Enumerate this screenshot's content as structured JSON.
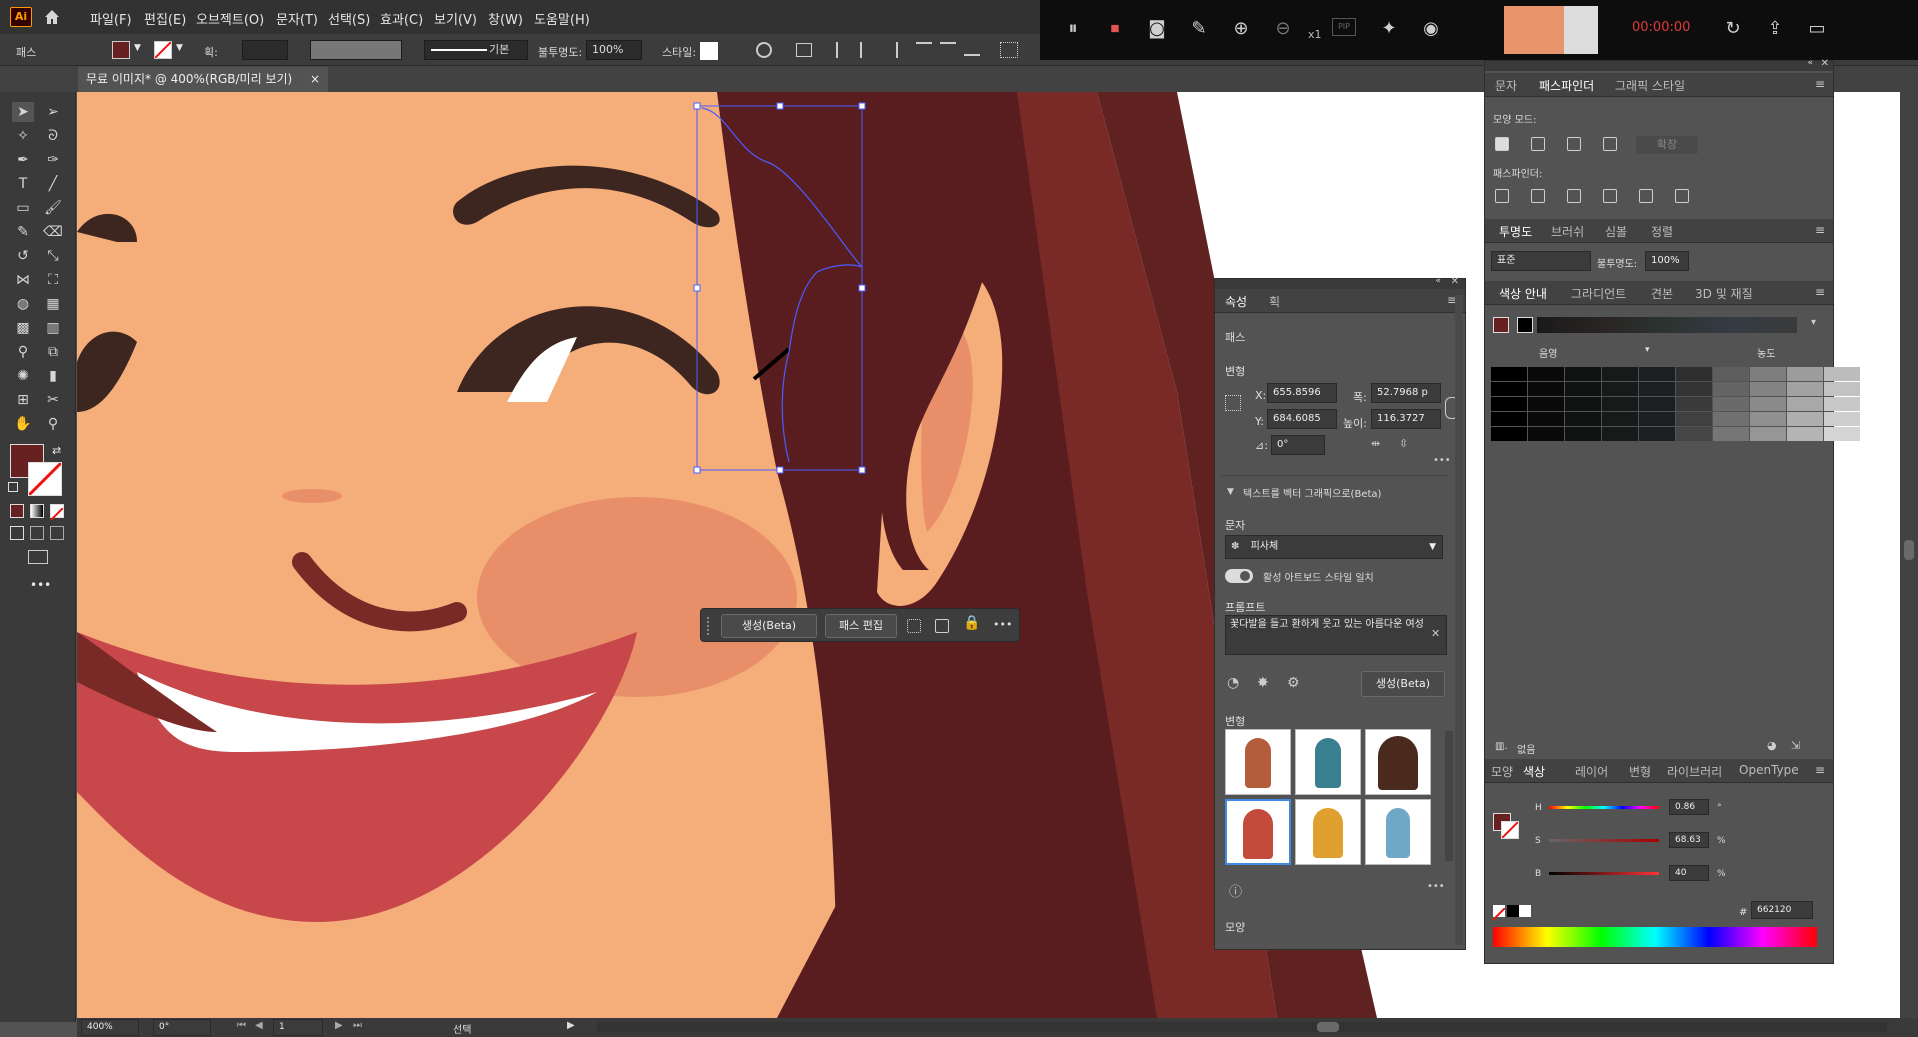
{
  "app": {
    "logo": "Ai",
    "menu": [
      "파일(F)",
      "편집(E)",
      "오브젝트(O)",
      "문자(T)",
      "선택(S)",
      "효과(C)",
      "보기(V)",
      "창(W)",
      "도움말(H)"
    ]
  },
  "control_bar": {
    "object_type": "패스",
    "stroke_label": "획:",
    "stroke_style": "기본",
    "opacity_label": "불투명도:",
    "opacity_value": "100%",
    "style_label": "스타일:"
  },
  "document": {
    "tab_title": "무료 이미지* @ 400%(RGB/미리 보기)",
    "close": "×"
  },
  "recorder": {
    "time": "00:00:00",
    "zoom_label": "x1",
    "pip_label": "PIP"
  },
  "context_toolbar": {
    "generate": "생성(Beta)",
    "edit_path": "패스 편집",
    "more": "•••"
  },
  "properties_panel": {
    "tabs": [
      "속성",
      "획"
    ],
    "section_path": "패스",
    "section_transform": "변형",
    "x_label": "X:",
    "x_value": "655.8596",
    "y_label": "Y:",
    "y_value": "684.6085",
    "w_label": "폭:",
    "w_value": "52.7968 p",
    "h_label": "높이:",
    "h_value": "116.3727",
    "angle_label": "⊿:",
    "angle_value": "0°",
    "more": "•••",
    "vector_section": "텍스트를 벡터 그래픽으로(Beta)",
    "subject_label": "문자",
    "subject_value": "피사체",
    "toggle_label": "활성 아트보드 스타일 일치",
    "prompt_label": "프롬프트",
    "prompt_text": "꽃다발을 들고 환하게 웃고 있는 아름다운 여성",
    "generate_button": "생성(Beta)",
    "variations_label": "변형",
    "appearance_label": "모양"
  },
  "pathfinder_panel": {
    "tabs": [
      "문자",
      "패스파인더",
      "그래픽 스타일"
    ],
    "shape_modes": "모양 모드:",
    "expand": "확장",
    "pathfinders": "패스파인더:"
  },
  "transparency_panel": {
    "tabs": [
      "투명도",
      "브러쉬",
      "심볼",
      "정렬"
    ],
    "blend_mode": "표준",
    "opacity_label": "불투명도:",
    "opacity_value": "100%"
  },
  "color_guide_panel": {
    "tabs": [
      "색상 안내",
      "그라디언트",
      "견본",
      "3D 및 재질"
    ],
    "left_label": "음영",
    "right_label": "농도",
    "footer_none": "없음"
  },
  "color_panel": {
    "tabs": [
      "모양",
      "색상",
      "레이어",
      "변형",
      "라이브러리",
      "OpenType"
    ],
    "h_label": "H",
    "h_value": "0.86",
    "h_unit": "°",
    "s_label": "S",
    "s_value": "68.63",
    "s_unit": "%",
    "b_label": "B",
    "b_value": "40",
    "b_unit": "%",
    "hex_label": "#",
    "hex_value": "662120"
  },
  "status_bar": {
    "zoom": "400%",
    "rotation": "0°",
    "artboard": "1",
    "mode": "선택"
  },
  "colors": {
    "fill": "#662120",
    "skin": "#f5ad7a",
    "hair_dark": "#5a1d1f",
    "hair_mid": "#7a2a26",
    "brow": "#3d2520",
    "lip": "#c8474a",
    "cheek": "#e88f6a",
    "selection": "#4a5cff",
    "ui_panel": "#535353"
  }
}
